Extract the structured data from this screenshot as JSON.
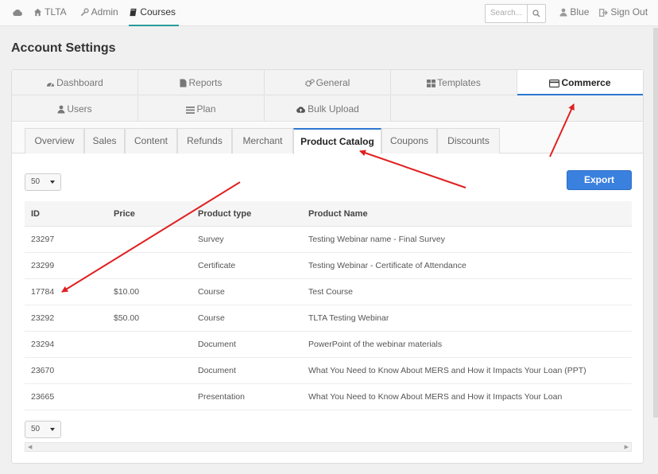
{
  "nav": {
    "brand": "TLTA",
    "admin": "Admin",
    "courses": "Courses",
    "search_placeholder": "Search...",
    "user": "Blue",
    "signout": "Sign Out"
  },
  "page_title": "Account Settings",
  "main_tabs": {
    "dashboard": "Dashboard",
    "reports": "Reports",
    "general": "General",
    "templates": "Templates",
    "commerce": "Commerce",
    "users": "Users",
    "plan": "Plan",
    "bulk_upload": "Bulk Upload"
  },
  "sub_tabs": {
    "overview": "Overview",
    "sales": "Sales",
    "content": "Content",
    "refunds": "Refunds",
    "merchant": "Merchant",
    "product_catalog": "Product Catalog",
    "coupons": "Coupons",
    "discounts": "Discounts"
  },
  "page_size": "50",
  "export_label": "Export",
  "table": {
    "headers": [
      "ID",
      "Price",
      "Product type",
      "Product Name"
    ],
    "rows": [
      [
        "23297",
        "",
        "Survey",
        "Testing Webinar name - Final Survey"
      ],
      [
        "23299",
        "",
        "Certificate",
        "Testing Webinar - Certificate of Attendance"
      ],
      [
        "17784",
        "$10.00",
        "Course",
        "Test Course"
      ],
      [
        "23292",
        "$50.00",
        "Course",
        "TLTA Testing Webinar"
      ],
      [
        "23294",
        "",
        "Document",
        "PowerPoint of the webinar materials"
      ],
      [
        "23670",
        "",
        "Document",
        "What You Need to Know About MERS and How it Impacts Your Loan (PPT)"
      ],
      [
        "23665",
        "",
        "Presentation",
        "What You Need to Know About MERS and How it Impacts Your Loan"
      ]
    ]
  },
  "colors": {
    "accent_blue": "#2e77d0",
    "export_button": "#3a80de",
    "nav_active": "#2a9a9a",
    "annotation_arrow": "#e02020"
  },
  "icons": [
    "cloud-icon",
    "home-icon",
    "wrench-icon",
    "book-icon",
    "search-icon",
    "user-icon",
    "signout-icon",
    "dashboard-icon",
    "file-icon",
    "gears-icon",
    "templates-icon",
    "credit-card-icon",
    "users-icon",
    "plan-icon",
    "cloud-upload-icon"
  ]
}
